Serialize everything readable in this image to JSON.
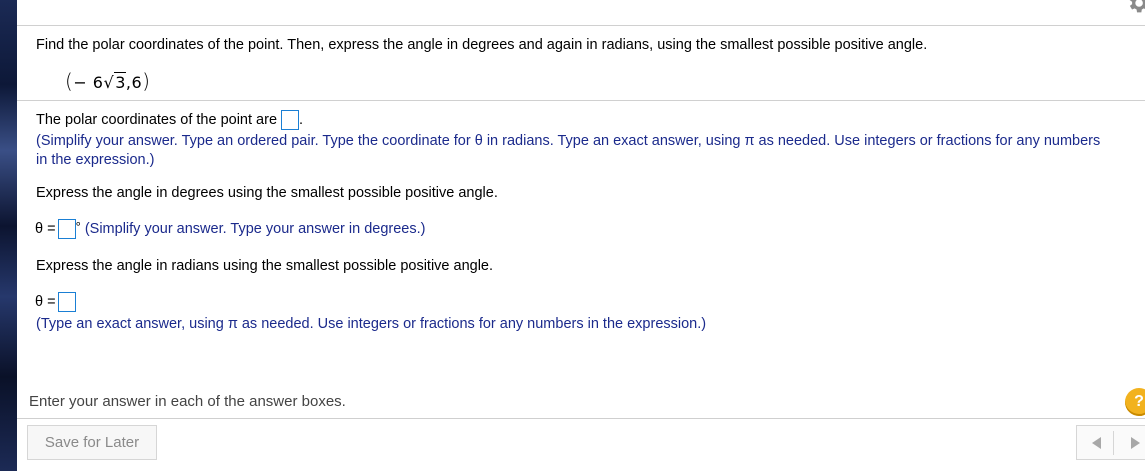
{
  "question": {
    "prompt": "Find the polar coordinates of the point. Then, express the angle in degrees and again in radians, using the smallest possible positive angle.",
    "point": {
      "open": "(",
      "x_coef": "− 6",
      "radicand": "3",
      "comma": ",",
      "y": "6",
      "close": ")"
    }
  },
  "part1": {
    "label": "The polar coordinates of the point are",
    "after": ".",
    "hint_line1": "(Simplify your answer. Type an ordered pair. Type the coordinate for θ in radians. Type an exact answer, using π as needed. Use integers or fractions for any numbers",
    "hint_line2": "in the expression.)"
  },
  "part2": {
    "prompt": "Express the angle in degrees using the smallest possible positive angle.",
    "theta_label": "θ =",
    "degree_symbol": "°",
    "hint": "(Simplify your answer. Type your answer in degrees.)"
  },
  "part3": {
    "prompt": "Express the angle in radians using the smallest possible positive angle.",
    "theta_label": "θ =",
    "hint": "(Type an exact answer, using π as needed. Use integers or fractions for any numbers in the expression.)"
  },
  "footer": {
    "help_text": "Enter your answer in each of the answer boxes.",
    "help_icon": "?",
    "save_label": "Save for Later"
  },
  "icons": {
    "gear": "gear-icon",
    "help": "help-icon",
    "prev": "triangle-left-icon",
    "next": "triangle-right-icon"
  },
  "colors": {
    "hint_blue": "#1b2a8c",
    "input_border": "#1a7fd4",
    "help_orange": "#f2b21e"
  }
}
